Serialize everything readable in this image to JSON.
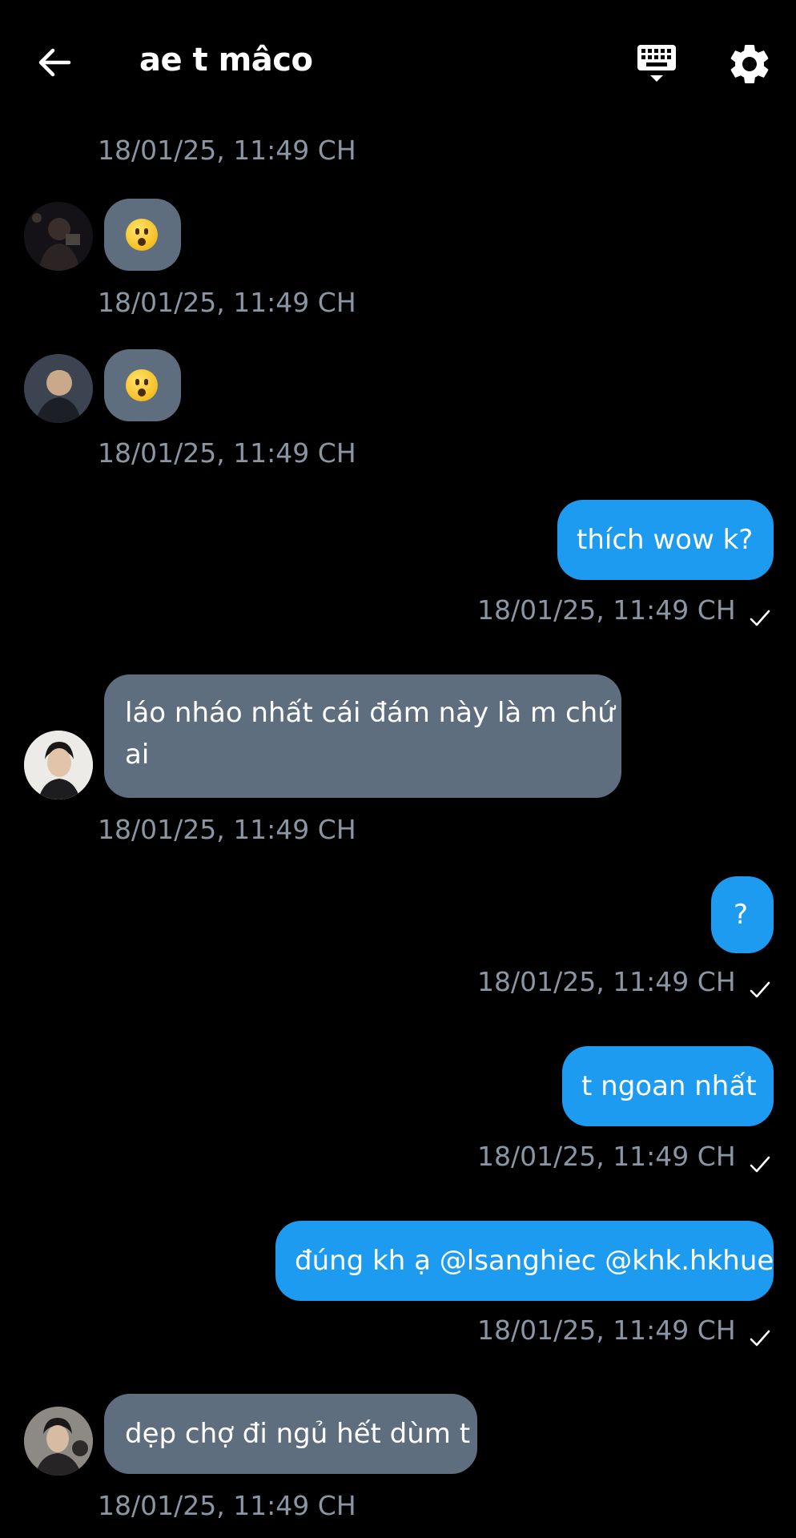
{
  "header": {
    "title": "ae t mâco"
  },
  "messages": [
    {
      "direction": "in",
      "type": "emoji",
      "emoji": "😮",
      "timestamp": "18/01/25, 11:49 CH"
    },
    {
      "direction": "in",
      "type": "emoji",
      "emoji": "😮",
      "timestamp": "18/01/25, 11:49 CH"
    },
    {
      "direction": "out",
      "type": "text",
      "text": "thích wow k?",
      "timestamp": "18/01/25, 11:49 CH"
    },
    {
      "direction": "in",
      "type": "text",
      "line1": "láo nháo nhất cái đám này là m chứ",
      "line2": "ai",
      "timestamp": "18/01/25, 11:49 CH"
    },
    {
      "direction": "out",
      "type": "text",
      "text": "?",
      "timestamp": "18/01/25, 11:49 CH"
    },
    {
      "direction": "out",
      "type": "text",
      "text": "t ngoan nhất",
      "timestamp": "18/01/25, 11:49 CH"
    },
    {
      "direction": "out",
      "type": "text",
      "text": "đúng kh ạ @lsanghiec @khk.hkhue",
      "timestamp": "18/01/25, 11:49 CH"
    },
    {
      "direction": "in",
      "type": "text",
      "text": "dẹp chợ đi ngủ hết dùm t",
      "timestamp": "18/01/25, 11:49 CH"
    }
  ],
  "top_partial_timestamp": "18/01/25, 11:49 CH",
  "colors": {
    "background": "#000000",
    "incoming_bubble": "#5f6e7e",
    "outgoing_bubble": "#1d9bf0",
    "timestamp": "#8a96a3"
  },
  "icons": [
    "back-arrow-icon",
    "keyboard-icon",
    "gear-icon",
    "read-check-icon"
  ]
}
